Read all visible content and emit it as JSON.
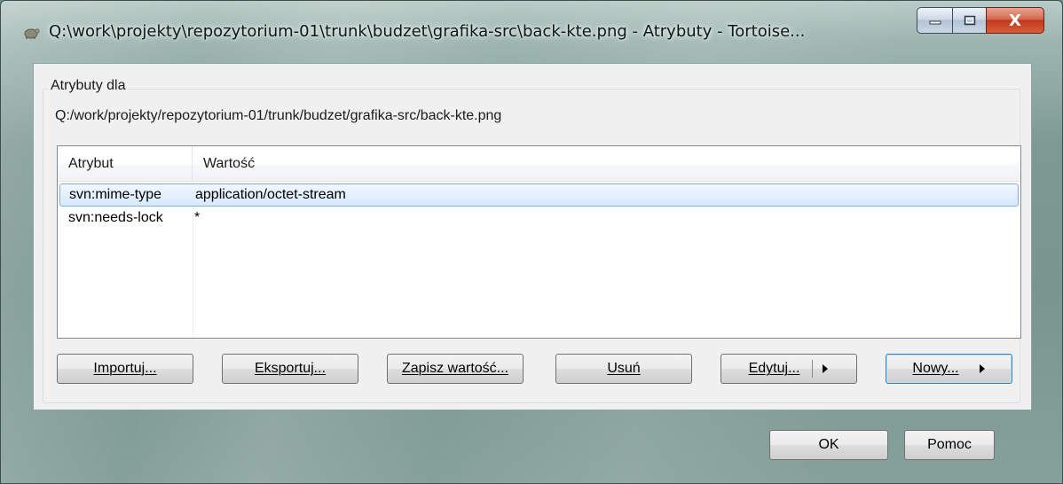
{
  "window": {
    "title": "Q:\\work\\projekty\\repozytorium-01\\trunk\\budzet\\grafika-src\\back-kte.png - Atrybuty - Tortoise...",
    "close_glyph": "X"
  },
  "group": {
    "label": "Atrybuty dla",
    "path": "Q:/work/projekty/repozytorium-01/trunk/budzet/grafika-src/back-kte.png"
  },
  "list": {
    "columns": [
      "Atrybut",
      "Wartość"
    ],
    "rows": [
      {
        "attr": "svn:mime-type",
        "value": "application/octet-stream",
        "selected": true
      },
      {
        "attr": "svn:needs-lock",
        "value": "*",
        "selected": false
      }
    ]
  },
  "buttons": {
    "import": "Importuj...",
    "export": "Eksportuj...",
    "save_value": "Zapisz wartość...",
    "remove": "Usuń",
    "edit": "Edytuj...",
    "new": "Nowy...",
    "ok": "OK",
    "help": "Pomoc"
  },
  "colors": {
    "selection_fill": "#d6e9fd",
    "selection_border": "#84acdd",
    "close_button": "#c2391b"
  }
}
